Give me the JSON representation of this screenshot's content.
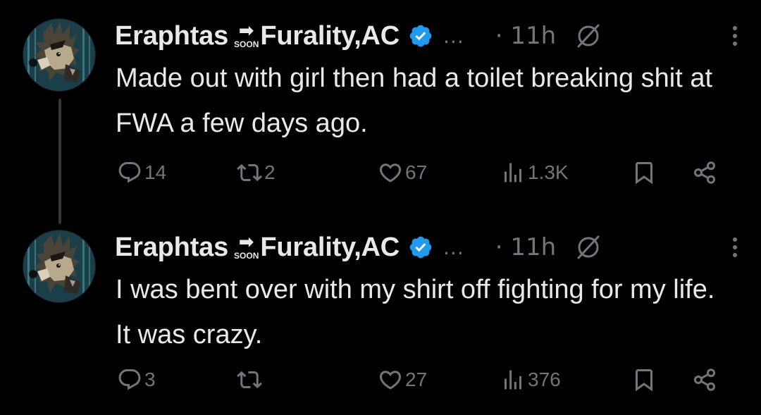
{
  "colors": {
    "background": "#000000",
    "text_primary": "#e7e9ea",
    "text_secondary": "#71767b",
    "verified_blue": "#1d9bf0",
    "thread_line": "#333639"
  },
  "tweets": [
    {
      "author": {
        "display_name_prefix": "Eraphtas",
        "arrow_glyph": "➡",
        "arrow_caption": "SOON",
        "display_name_suffix": "Furality,AC",
        "verified_icon": "verified-badge-icon",
        "overflow": "...",
        "avatar": "avatar-image"
      },
      "time_separator": "·",
      "time": "11h",
      "text": "Made out with girl then had a toilet breaking shit at FWA a few days ago.",
      "metrics": {
        "replies": "14",
        "reposts": "2",
        "likes": "67",
        "views": "1.3K"
      }
    },
    {
      "author": {
        "display_name_prefix": "Eraphtas",
        "arrow_glyph": "➡",
        "arrow_caption": "SOON",
        "display_name_suffix": "Furality,AC",
        "verified_icon": "verified-badge-icon",
        "overflow": "...",
        "avatar": "avatar-image"
      },
      "time_separator": "·",
      "time": "11h",
      "text": "I was bent over with my shirt off fighting for my life. It was crazy.",
      "metrics": {
        "replies": "3",
        "reposts": "",
        "likes": "27",
        "views": "376"
      }
    }
  ],
  "icons": {
    "reply": "reply-icon",
    "repost": "repost-icon",
    "like": "heart-icon",
    "views": "views-icon",
    "bookmark": "bookmark-icon",
    "share": "share-icon",
    "grok": "grok-icon",
    "more": "more-vertical-icon"
  }
}
